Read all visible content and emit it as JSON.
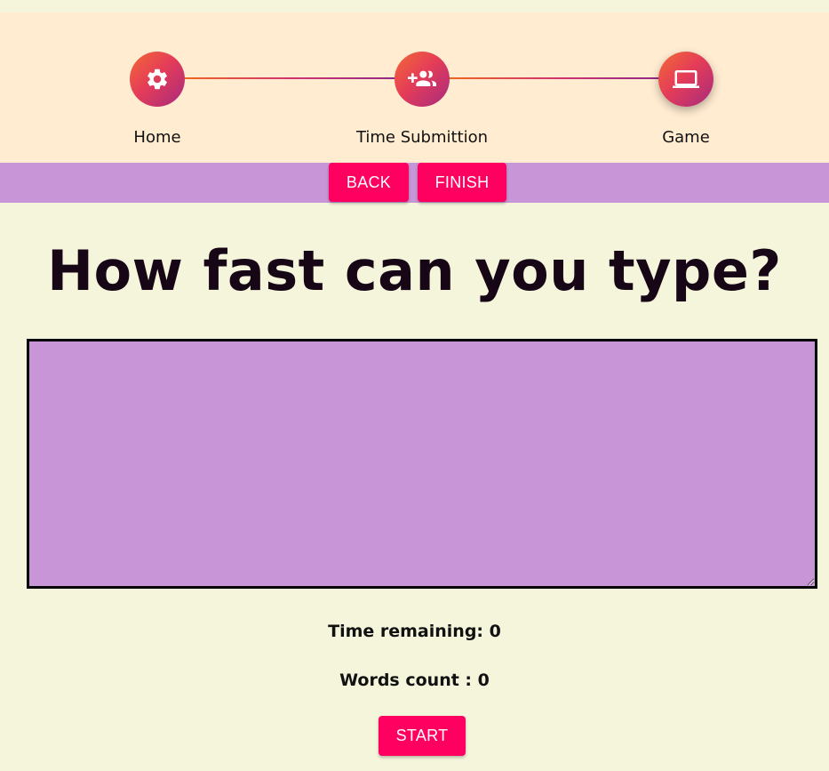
{
  "stepper": {
    "steps": [
      {
        "label": "Home",
        "icon": "gear-icon"
      },
      {
        "label": "Time Submittion",
        "icon": "group-add-icon"
      },
      {
        "label": "Game",
        "icon": "laptop-icon"
      }
    ],
    "active_step": 2
  },
  "nav": {
    "back_label": "BACK",
    "finish_label": "FINISH"
  },
  "game": {
    "title": "How fast can you type?",
    "input_value": "",
    "time_label": "Time remaining: ",
    "time_value": "0",
    "words_label": "Words count : ",
    "words_value": "0",
    "start_label": "START"
  },
  "colors": {
    "page_background": "#f5f5dc",
    "stepper_background": "#ffecd1",
    "accent_purple": "#c896d6",
    "button_pink": "#ff0060"
  }
}
